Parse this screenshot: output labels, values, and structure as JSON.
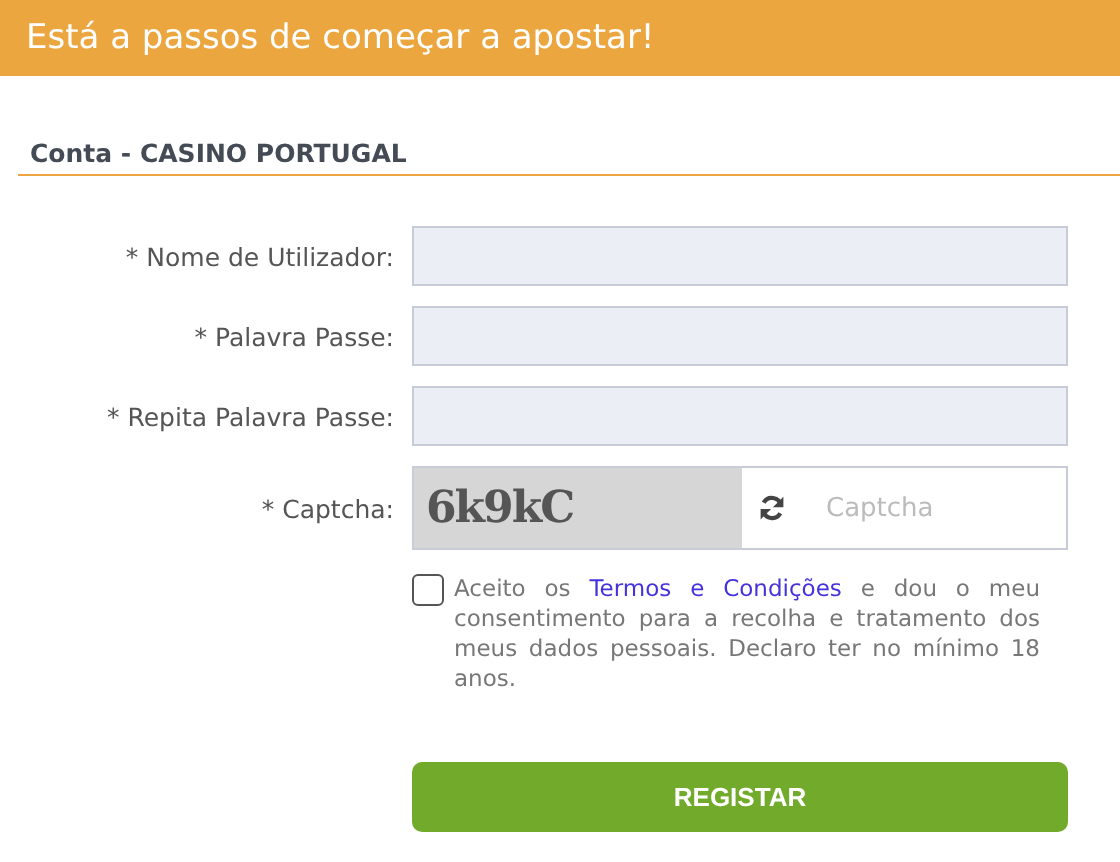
{
  "header": {
    "title": "Está a passos de começar a apostar!"
  },
  "section": {
    "title": "Conta - CASINO PORTUGAL"
  },
  "fields": [
    {
      "label": "* Nome de Utilizador:"
    },
    {
      "label": "* Palavra Passe:"
    },
    {
      "label": "* Repita Palavra Passe:"
    }
  ],
  "captcha": {
    "label": "* Captcha:",
    "code": "6k9kC",
    "placeholder": "Captcha"
  },
  "terms": {
    "checked": false,
    "before": "Aceito os",
    "link": "Termos e Condições",
    "after": "e dou o meu consentimento para a recolha e tratamento dos meus dados pessoais. Declaro ter no mínimo 18 anos."
  },
  "submit": {
    "label": "REGISTAR"
  }
}
